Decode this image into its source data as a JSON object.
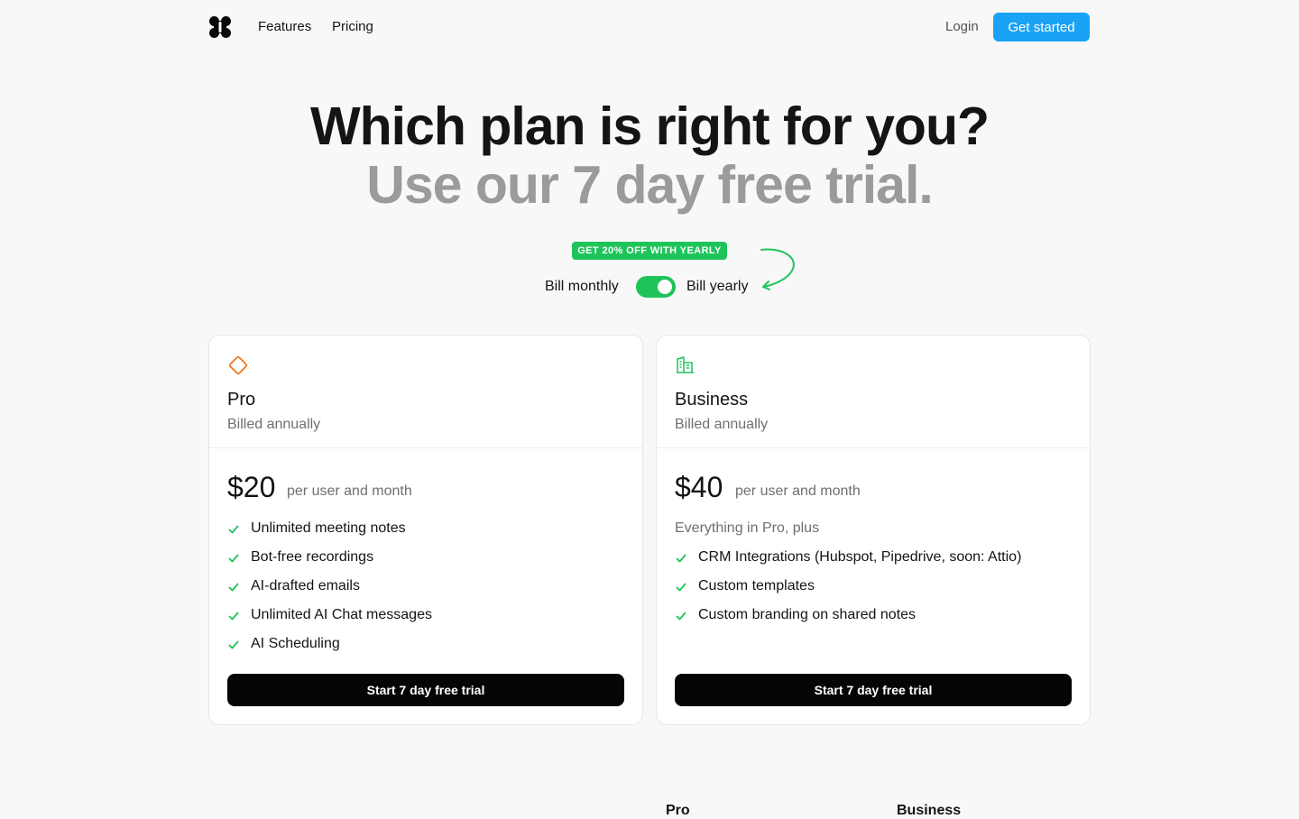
{
  "nav": {
    "logo": "logo",
    "links": [
      "Features",
      "Pricing"
    ],
    "login": "Login",
    "cta": "Get started",
    "cta_color": "#1aa2f5"
  },
  "hero": {
    "line1": "Which plan is right for you?",
    "line2": "Use our 7 day free trial."
  },
  "billing": {
    "badge": "GET 20% OFF WITH YEARLY",
    "monthly_label": "Bill monthly",
    "yearly_label": "Bill yearly",
    "yearly_selected": true,
    "accent_color": "#1ec45a"
  },
  "plans": [
    {
      "icon": "diamond-icon",
      "icon_color": "#f07b22",
      "name": "Pro",
      "billing": "Billed annually",
      "price": "$20",
      "price_unit": "per user and month",
      "intro": "",
      "features": [
        "Unlimited meeting notes",
        "Bot-free recordings",
        "AI-drafted emails",
        "Unlimited AI Chat messages",
        "AI Scheduling"
      ],
      "cta": "Start 7 day free trial"
    },
    {
      "icon": "buildings-icon",
      "icon_color": "#1ec45a",
      "name": "Business",
      "billing": "Billed annually",
      "price": "$40",
      "price_unit": "per user and month",
      "intro": "Everything in Pro, plus",
      "features": [
        "CRM Integrations (Hubspot, Pipedrive, soon: Attio)",
        "Custom templates",
        "Custom branding on shared notes"
      ],
      "cta": "Start 7 day free trial"
    }
  ],
  "comparison_headers": [
    "Pro",
    "Business"
  ]
}
